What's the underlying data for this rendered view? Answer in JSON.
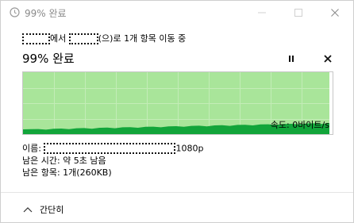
{
  "window": {
    "title": "99% 완료"
  },
  "operation": {
    "from_suffix": "에서",
    "to_suffix": "(으)로 1개 항목 이동 중"
  },
  "progress": {
    "title": "99% 완료",
    "percent": 99
  },
  "chart": {
    "speed_text": "속도: 0바이트/s",
    "fill_color": "#a9e59a",
    "line_color": "#12a53a"
  },
  "details": {
    "name_label": "이름:",
    "name_suffix": "1080p",
    "time_remaining": "남은 시간: 약 5초 남음",
    "items_remaining": "남은 항목: 1개(260KB)"
  },
  "footer": {
    "collapse_label": "간단히"
  },
  "icons": {
    "app": "clock-icon",
    "pause": "pause-icon",
    "cancel": "close-icon",
    "collapse": "chevron-up-icon"
  }
}
